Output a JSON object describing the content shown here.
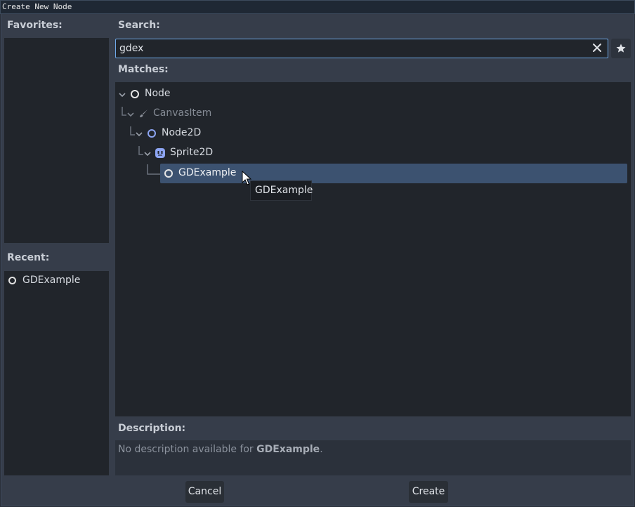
{
  "window": {
    "title": "Create New Node"
  },
  "favorites": {
    "label": "Favorites:"
  },
  "recent": {
    "label": "Recent:",
    "items": [
      {
        "label": "GDExample",
        "icon": "circle-node-icon"
      }
    ]
  },
  "search": {
    "label": "Search:",
    "value": "gdex",
    "clear_icon": "close-icon",
    "favorite_icon": "star-icon"
  },
  "matches": {
    "label": "Matches:",
    "tree": [
      {
        "label": "Node",
        "icon": "circle-node-icon",
        "dimmed": false
      },
      {
        "label": "CanvasItem",
        "icon": "brush-icon",
        "dimmed": true
      },
      {
        "label": "Node2D",
        "icon": "circle-node2d-icon",
        "dimmed": false
      },
      {
        "label": "Sprite2D",
        "icon": "sprite-icon",
        "dimmed": false
      },
      {
        "label": "GDExample",
        "icon": "circle-node-icon",
        "dimmed": false,
        "selected": true
      }
    ]
  },
  "tooltip": {
    "text": "GDExample"
  },
  "description": {
    "label": "Description:",
    "prefix": "No description available for ",
    "name": "GDExample",
    "suffix": "."
  },
  "buttons": {
    "cancel": "Cancel",
    "create": "Create"
  },
  "colors": {
    "accent": "#6fa9e8",
    "selection": "#3c5270",
    "node2d": "#8da5f3"
  }
}
